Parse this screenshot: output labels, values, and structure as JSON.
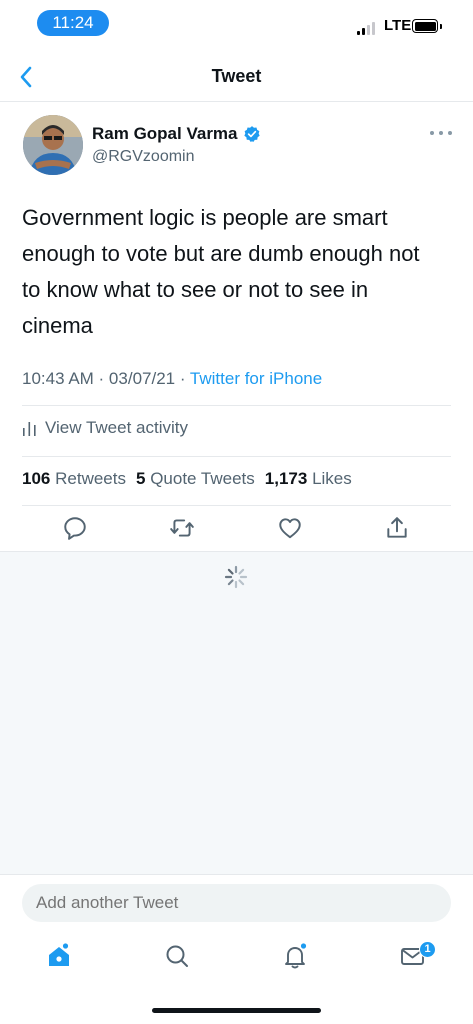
{
  "status_bar": {
    "time": "11:24",
    "carrier": "LTE"
  },
  "header": {
    "title": "Tweet"
  },
  "tweet": {
    "author_name": "Ram Gopal Varma",
    "handle": "@RGVzoomin",
    "text": "Government logic is people are smart enough to vote but are dumb enough not to know what to see or not to see in cinema",
    "time": "10:43 AM · 03/07/21 · ",
    "source": "Twitter for iPhone",
    "activity_label": "View Tweet activity",
    "stats": {
      "retweets_count": "106",
      "retweets_label": "Retweets",
      "quotes_count": "5",
      "quotes_label": "Quote Tweets",
      "likes_count": "1,173",
      "likes_label": "Likes"
    }
  },
  "reply": {
    "placeholder": "Add another Tweet"
  },
  "tabbar": {
    "messages_badge": "1"
  },
  "colors": {
    "accent": "#1d9bf0",
    "time_pill": "#1d8cf0",
    "text": "#0f1419",
    "secondary": "#536471"
  },
  "icons": [
    "back-icon",
    "verified-icon",
    "more-icon",
    "activity-icon",
    "reply-icon",
    "retweet-icon",
    "like-icon",
    "share-icon",
    "spinner-icon",
    "home-icon",
    "search-icon",
    "notifications-icon",
    "messages-icon"
  ]
}
